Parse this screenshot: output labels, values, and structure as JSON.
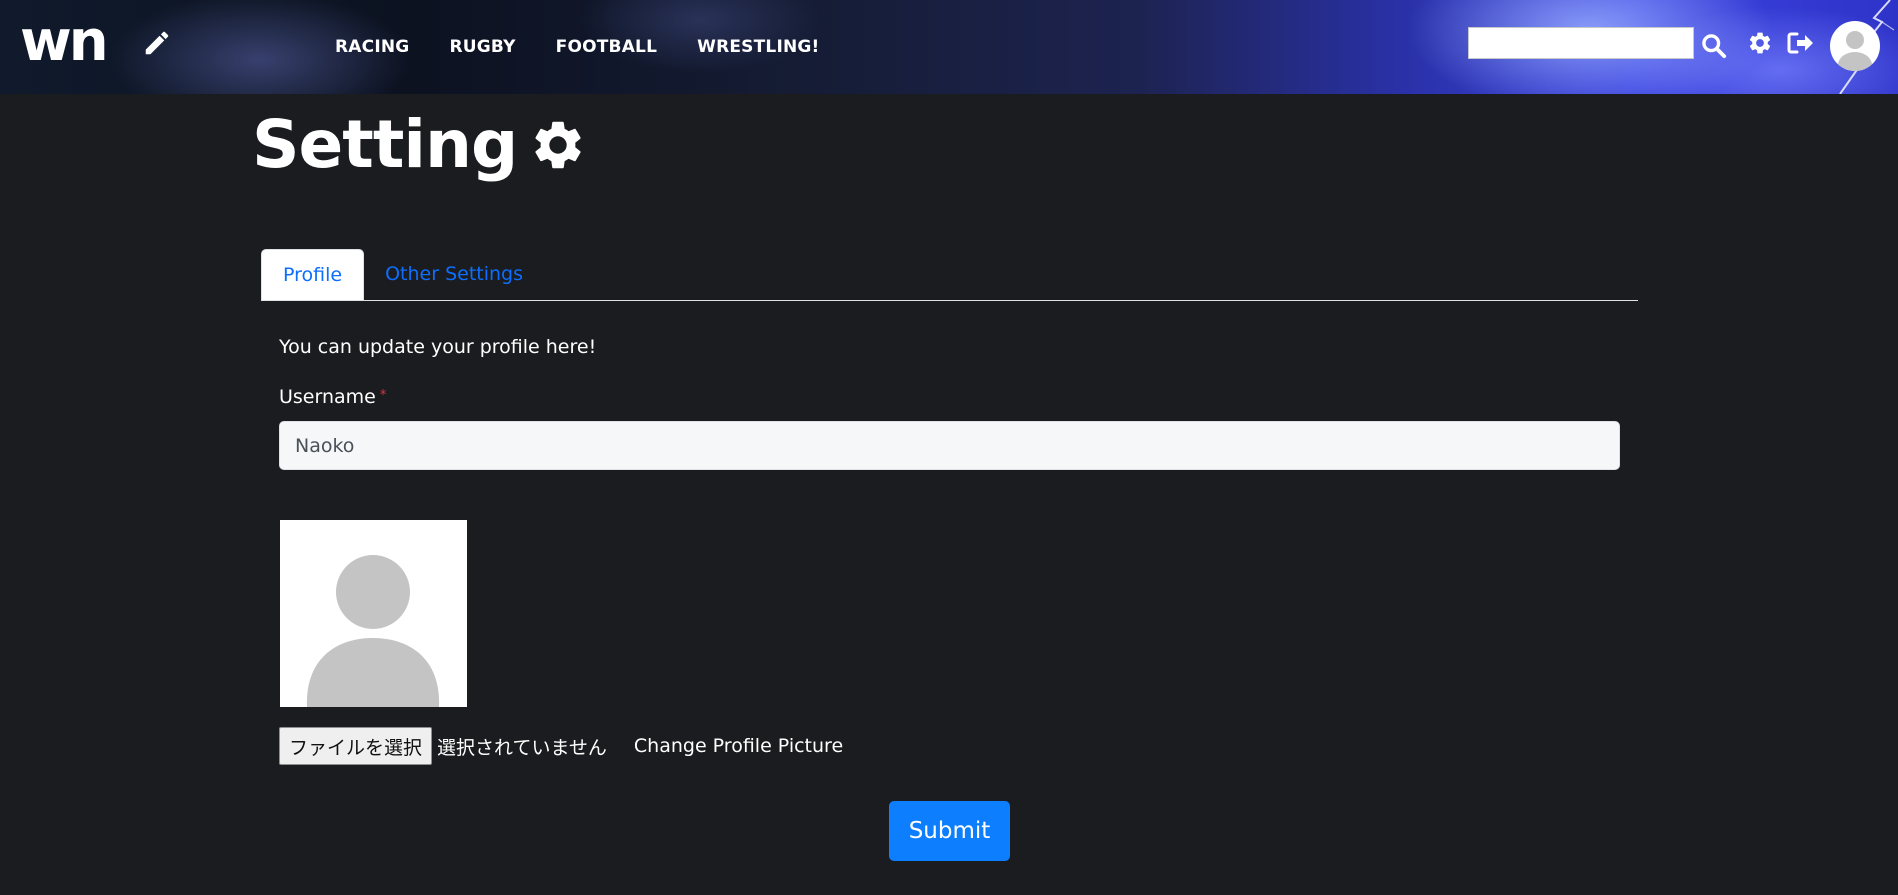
{
  "header": {
    "logo_text": "wn",
    "nav": [
      "RACING",
      "RUGBY",
      "FOOTBALL",
      "WRESTLING!"
    ],
    "search": {
      "value": "",
      "placeholder": ""
    }
  },
  "page": {
    "title": "Setting",
    "tabs": [
      {
        "label": "Profile",
        "active": true
      },
      {
        "label": "Other Settings",
        "active": false
      }
    ],
    "intro": "You can update your profile here!",
    "username": {
      "label": "Username",
      "required_mark": "*",
      "value": "Naoko"
    },
    "file_input": {
      "button_label": "ファイルを選択",
      "status": "選択されていません"
    },
    "change_picture_label": "Change Profile Picture",
    "submit_label": "Submit"
  },
  "colors": {
    "background": "#1b1c1f",
    "accent": "#0d7efd",
    "link": "#0d6efd",
    "required": "#dc3545"
  },
  "icons": [
    "pencil-icon",
    "search-icon",
    "gear-icon",
    "logout-icon",
    "avatar",
    "gear-title-icon"
  ]
}
